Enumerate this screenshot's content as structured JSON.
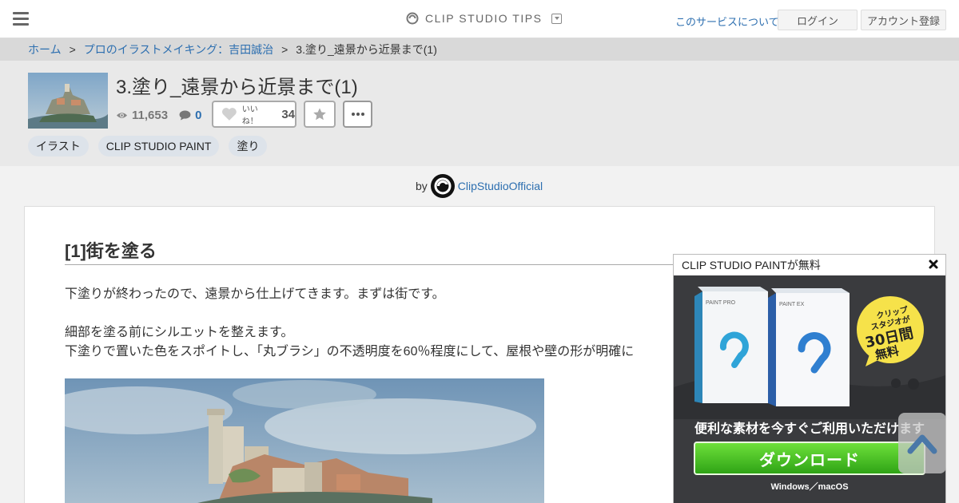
{
  "topbar": {
    "brand": "CLIP STUDIO TIPS",
    "about_link": "このサービスについて",
    "login": "ログイン",
    "register": "アカウント登録"
  },
  "breadcrumb": {
    "home": "ホーム",
    "series": "プロのイラストメイキング：吉田誠治",
    "current": "3.塗り_遠景から近景まで(1)",
    "sep": ">"
  },
  "article": {
    "title": "3.塗り_遠景から近景まで(1)",
    "views": "11,653",
    "comments": "0",
    "like_label": "いいね！",
    "like_count": "34",
    "tags": [
      "イラスト",
      "CLIP STUDIO PAINT",
      "塗り"
    ]
  },
  "author": {
    "by": "by",
    "name": "ClipStudioOfficial"
  },
  "content": {
    "heading": "[1]街を塗る",
    "p1": "下塗りが終わったので、遠景から仕上げてきます。まずは街です。",
    "p2": "細部を塗る前にシルエットを整えます。",
    "p3": "下塗りで置いた色をスポイトし、「丸ブラシ」の不透明度を60％程度にして、屋根や壁の形が明確に"
  },
  "ad": {
    "header": "CLIP STUDIO PAINTが無料",
    "tagline": "便利な素材を今すぐご利用いただけます",
    "download": "ダウンロード",
    "os": "Windows／macOS",
    "badge_line1": "クリップ",
    "badge_line2": "スタジオが",
    "badge_line3": "30日間",
    "badge_line4": "無料",
    "box1_label": "PAINT PRO",
    "box2_label": "PAINT EX"
  },
  "colors": {
    "link": "#2d6fb0",
    "download_green": "#3cb521",
    "badge_yellow": "#f6e24a"
  }
}
